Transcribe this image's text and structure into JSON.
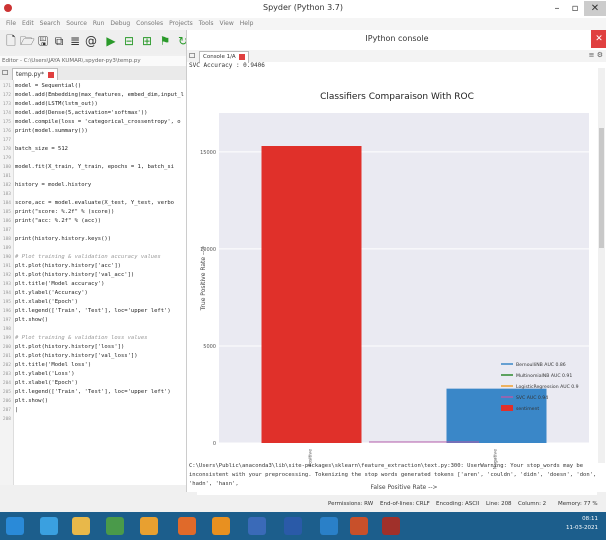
{
  "window": {
    "title": "Spyder (Python 3.7)",
    "minimize": "–",
    "maximize": "▫",
    "close": "✕"
  },
  "menu": [
    "File",
    "Edit",
    "Search",
    "Source",
    "Run",
    "Debug",
    "Consoles",
    "Projects",
    "Tools",
    "View",
    "Help"
  ],
  "editor": {
    "path": "Editor - C:\\Users\\JAYA KUMAR\\.spyder-py3\\temp.py",
    "tab": "temp.py*",
    "lines": [
      {
        "n": "171",
        "t": "model = Sequential()",
        "k": "code"
      },
      {
        "n": "172",
        "t": "model.add(Embedding(max_features, embed_dim,input_l",
        "k": "code"
      },
      {
        "n": "173",
        "t": "model.add(LSTM(lstm_out))",
        "k": "code"
      },
      {
        "n": "174",
        "t": "model.add(Dense(5,activation='softmax'))",
        "k": "code"
      },
      {
        "n": "175",
        "t": "model.compile(loss = 'categorical_crossentropy', o",
        "k": "code"
      },
      {
        "n": "176",
        "t": "print(model.summary())",
        "k": "code"
      },
      {
        "n": "177",
        "t": "",
        "k": "code"
      },
      {
        "n": "178",
        "t": "batch_size = 512",
        "k": "code"
      },
      {
        "n": "179",
        "t": "",
        "k": "code"
      },
      {
        "n": "180",
        "t": "model.fit(X_train, Y_train, epochs = 1, batch_si",
        "k": "code"
      },
      {
        "n": "181",
        "t": "",
        "k": "code"
      },
      {
        "n": "182",
        "t": "history = model.history",
        "k": "code"
      },
      {
        "n": "183",
        "t": "",
        "k": "code"
      },
      {
        "n": "184",
        "t": "score,acc = model.evaluate(X_test, Y_test, verbo",
        "k": "code"
      },
      {
        "n": "185",
        "t": "print(\"score: %.2f\" % (score))",
        "k": "code"
      },
      {
        "n": "186",
        "t": "print(\"acc: %.2f\" % (acc))",
        "k": "code"
      },
      {
        "n": "187",
        "t": "",
        "k": "code"
      },
      {
        "n": "188",
        "t": "print(history.history.keys())",
        "k": "code"
      },
      {
        "n": "189",
        "t": "",
        "k": "code"
      },
      {
        "n": "190",
        "t": "# Plot training & validation accuracy values",
        "k": "comment"
      },
      {
        "n": "191",
        "t": "plt.plot(history.history['acc'])",
        "k": "code"
      },
      {
        "n": "192",
        "t": "plt.plot(history.history['val_acc'])",
        "k": "code"
      },
      {
        "n": "193",
        "t": "plt.title('Model accuracy')",
        "k": "code"
      },
      {
        "n": "194",
        "t": "plt.ylabel('Accuracy')",
        "k": "code"
      },
      {
        "n": "195",
        "t": "plt.xlabel('Epoch')",
        "k": "code"
      },
      {
        "n": "196",
        "t": "plt.legend(['Train', 'Test'], loc='upper left')",
        "k": "code"
      },
      {
        "n": "197",
        "t": "plt.show()",
        "k": "code"
      },
      {
        "n": "198",
        "t": "",
        "k": "code"
      },
      {
        "n": "199",
        "t": "# Plot training & validation loss values",
        "k": "comment"
      },
      {
        "n": "200",
        "t": "plt.plot(history.history['loss'])",
        "k": "code"
      },
      {
        "n": "201",
        "t": "plt.plot(history.history['val_loss'])",
        "k": "code"
      },
      {
        "n": "202",
        "t": "plt.title('Model loss')",
        "k": "code"
      },
      {
        "n": "203",
        "t": "plt.ylabel('Loss')",
        "k": "code"
      },
      {
        "n": "204",
        "t": "plt.xlabel('Epoch')",
        "k": "code"
      },
      {
        "n": "205",
        "t": "plt.legend(['Train', 'Test'], loc='upper left')",
        "k": "code"
      },
      {
        "n": "206",
        "t": "plt.show()",
        "k": "code"
      },
      {
        "n": "207",
        "t": "|",
        "k": "code"
      },
      {
        "n": "208",
        "t": "",
        "k": "code"
      }
    ]
  },
  "console": {
    "title": "IPython console",
    "tab": "Console 1/A",
    "svc_text": "SVC Accuracy : 0.9406",
    "warning": "C:\\Users\\Public\\anaconda3\\lib\\site-packages\\sklearn\\feature_extraction\\text.py:300: UserWarning: Your stop_words may be inconsistent with your preprocessing. Tokenizing the stop words generated tokens ['aren', 'couldn', 'didn', 'doesn', 'don', 'hadn', 'hasn',"
  },
  "chart_data": {
    "type": "bar",
    "title": "Classifiers Comparaison With ROC",
    "xlabel": "False Positive Rate -->",
    "ylabel": "True Positive Rate -->",
    "categories": [
      "Positive",
      "Negative"
    ],
    "values": [
      15300,
      2800
    ],
    "bar_colors": [
      "#e0302a",
      "#3a87c8"
    ],
    "ylim": [
      0,
      17000
    ],
    "yticks": [
      0,
      5000,
      10000,
      15000
    ],
    "ytick_labels": [
      "0",
      "5000",
      "10000",
      "15000"
    ],
    "grid": true,
    "legend_position": "lower-right",
    "legend": [
      {
        "label": "BernoulliNB AUC 0.86",
        "color": "#3a87c8",
        "kind": "line"
      },
      {
        "label": "MultinomialNB AUC 0.91",
        "color": "#2e8b2e",
        "kind": "line"
      },
      {
        "label": "LogisticRegression AUC 0.9",
        "color": "#f0a030",
        "kind": "line"
      },
      {
        "label": "SVC AUC 0.94",
        "color": "#b05aa8",
        "kind": "line"
      },
      {
        "label": "sentiment",
        "color": "#e0302a",
        "kind": "patch"
      }
    ]
  },
  "status": {
    "permissions": "Permissions: RW",
    "eol": "End-of-lines: CRLF",
    "encoding": "Encoding: ASCII",
    "line": "Line: 208",
    "column": "Column: 2",
    "memory": "Memory: 77 %"
  },
  "taskbar": {
    "time": "08:11",
    "date": "11-03-2021",
    "icons": [
      "windows-start",
      "ie",
      "folder",
      "media",
      "chrome",
      "firefox",
      "vlc",
      "python",
      "word",
      "outlook",
      "powerpoint",
      "spyder"
    ]
  }
}
